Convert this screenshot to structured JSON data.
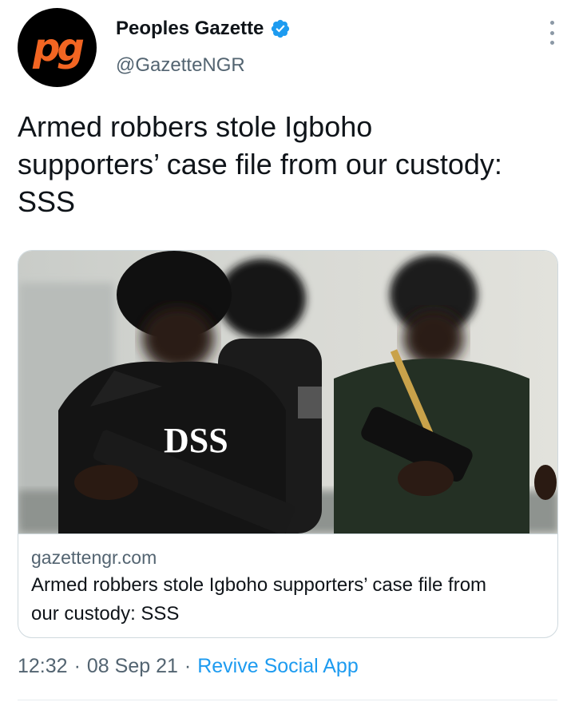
{
  "author": {
    "avatar_text": "pg",
    "display_name": "Peoples Gazette",
    "handle": "@GazetteNGR",
    "verified": true
  },
  "tweet": {
    "text": "Armed robbers stole Igboho supporters’ case file from our custody: SSS"
  },
  "card": {
    "image_label": "DSS",
    "domain": "gazettengr.com",
    "title": "Armed robbers stole Igboho supporters’ case file from our custody: SSS"
  },
  "footer": {
    "time": "12:32",
    "date": "08 Sep 21",
    "source": "Revive Social App"
  },
  "colors": {
    "accent": "#1d9bf0",
    "secondary_text": "#536471",
    "brand_orange": "#f26522"
  }
}
